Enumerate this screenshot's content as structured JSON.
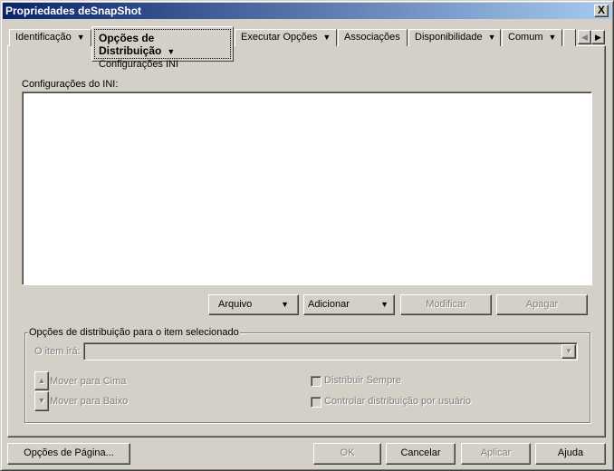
{
  "window": {
    "title": "Propriedades deSnapShot",
    "close_label": "X"
  },
  "tabs": [
    {
      "label": "Identificação",
      "dropdown": true
    },
    {
      "label": "Opções de Distribuição",
      "dropdown": true,
      "active": true,
      "subitem": "Configurações INI"
    },
    {
      "label": "Executar Opções",
      "dropdown": true
    },
    {
      "label": "Associações",
      "dropdown": false
    },
    {
      "label": "Disponibilidade",
      "dropdown": true
    },
    {
      "label": "Comum",
      "dropdown": true
    }
  ],
  "tab_scroll": {
    "left": "◀",
    "right": "▶"
  },
  "ini": {
    "label": "Configurações do INI:",
    "items": []
  },
  "buttons": {
    "arquivo": "Arquivo",
    "adicionar": "Adicionar",
    "modificar": "Modificar",
    "apagar": "Apagar"
  },
  "group": {
    "legend": "Opções de distribuição para o item selecionado",
    "item_label": "O item irá:",
    "item_value": "",
    "move_up": "Mover para Cima",
    "move_down": "Mover para Baixo",
    "distribute_always": "Distribuir Sempre",
    "track_per_user": "Controlar distribuição por usuário"
  },
  "footer": {
    "page_options": "Opções de Página...",
    "ok": "OK",
    "cancel": "Cancelar",
    "apply": "Aplicar",
    "help": "Ajuda"
  }
}
